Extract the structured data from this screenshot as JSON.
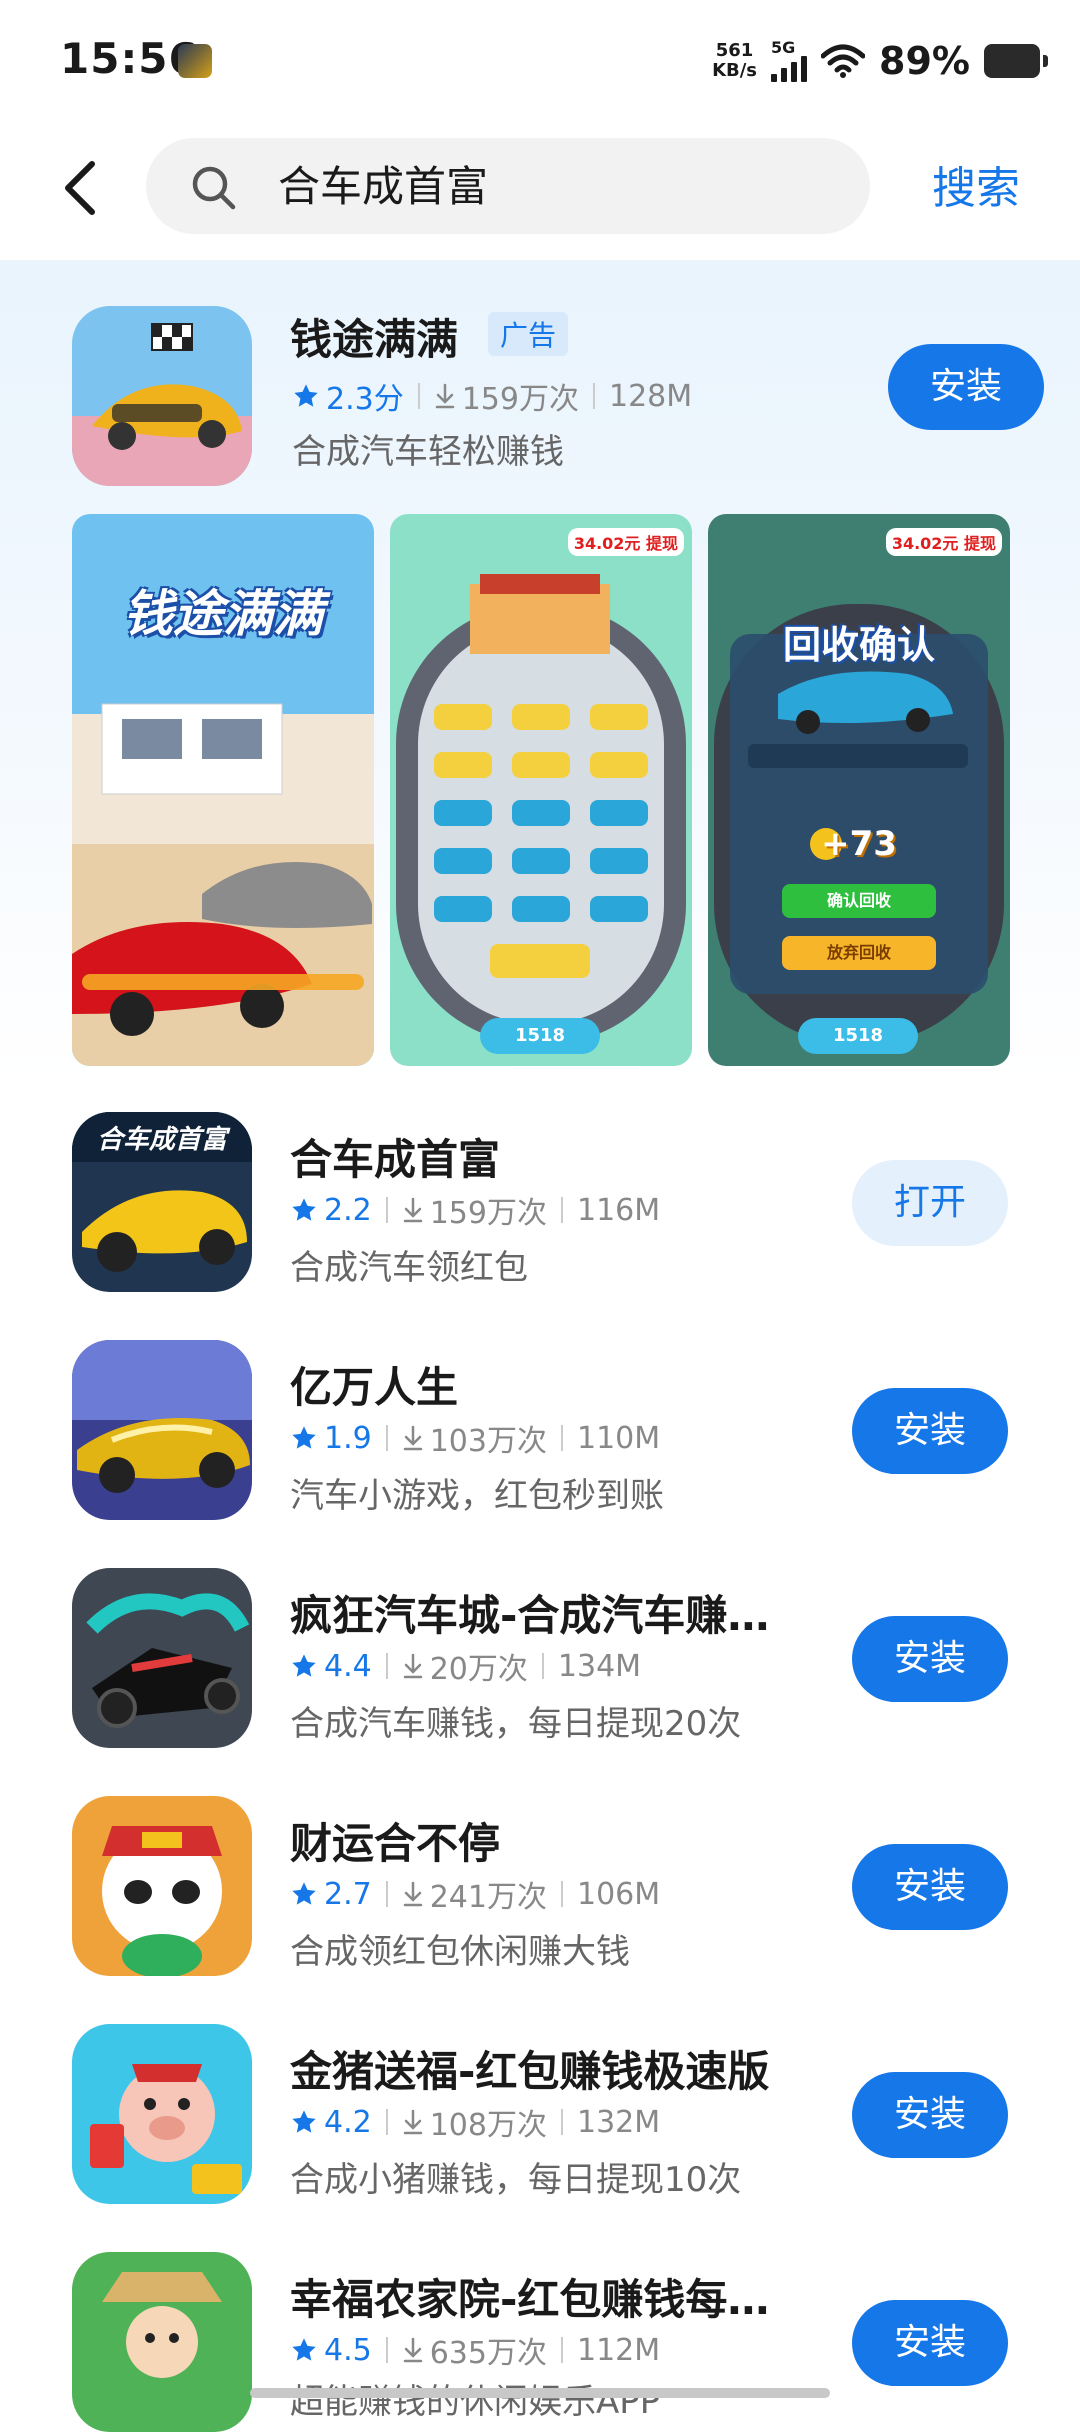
{
  "status_bar": {
    "time": "15:56",
    "net_speed_value": "561",
    "net_speed_unit": "KB/s",
    "network": "5G",
    "battery": "89%"
  },
  "search": {
    "query": "合车成首富",
    "button_label": "搜索"
  },
  "ad_app": {
    "name": "钱途满满",
    "badge": "广告",
    "rating": "2.3分",
    "downloads": "159万次",
    "size": "128M",
    "desc": "合成汽车轻松赚钱",
    "action": "安装",
    "screenshots": {
      "title": "钱途满满",
      "price": "34.02元 提现",
      "confirm_title": "回收确认",
      "reward": "+73",
      "confirm_btn": "确认回收",
      "abandon_btn": "放弃回收",
      "coins": "1518"
    }
  },
  "apps": [
    {
      "name": "合车成首富",
      "rating": "2.2",
      "downloads": "159万次",
      "size": "116M",
      "desc": "合成汽车领红包",
      "action": "打开"
    },
    {
      "name": "亿万人生",
      "rating": "1.9",
      "downloads": "103万次",
      "size": "110M",
      "desc": "汽车小游戏，红包秒到账",
      "action": "安装"
    },
    {
      "name": "疯狂汽车城-合成汽车赚…",
      "rating": "4.4",
      "downloads": "20万次",
      "size": "134M",
      "desc": "合成汽车赚钱，每日提现20次",
      "action": "安装"
    },
    {
      "name": "财运合不停",
      "rating": "2.7",
      "downloads": "241万次",
      "size": "106M",
      "desc": "合成领红包休闲赚大钱",
      "action": "安装"
    },
    {
      "name": "金猪送福-红包赚钱极速版",
      "rating": "4.2",
      "downloads": "108万次",
      "size": "132M",
      "desc": "合成小猪赚钱，每日提现10次",
      "action": "安装"
    },
    {
      "name": "幸福农家院-红包赚钱每…",
      "rating": "4.5",
      "downloads": "635万次",
      "size": "112M",
      "desc": "超能赚钱的休闲娱乐APP",
      "action": "安装"
    }
  ]
}
